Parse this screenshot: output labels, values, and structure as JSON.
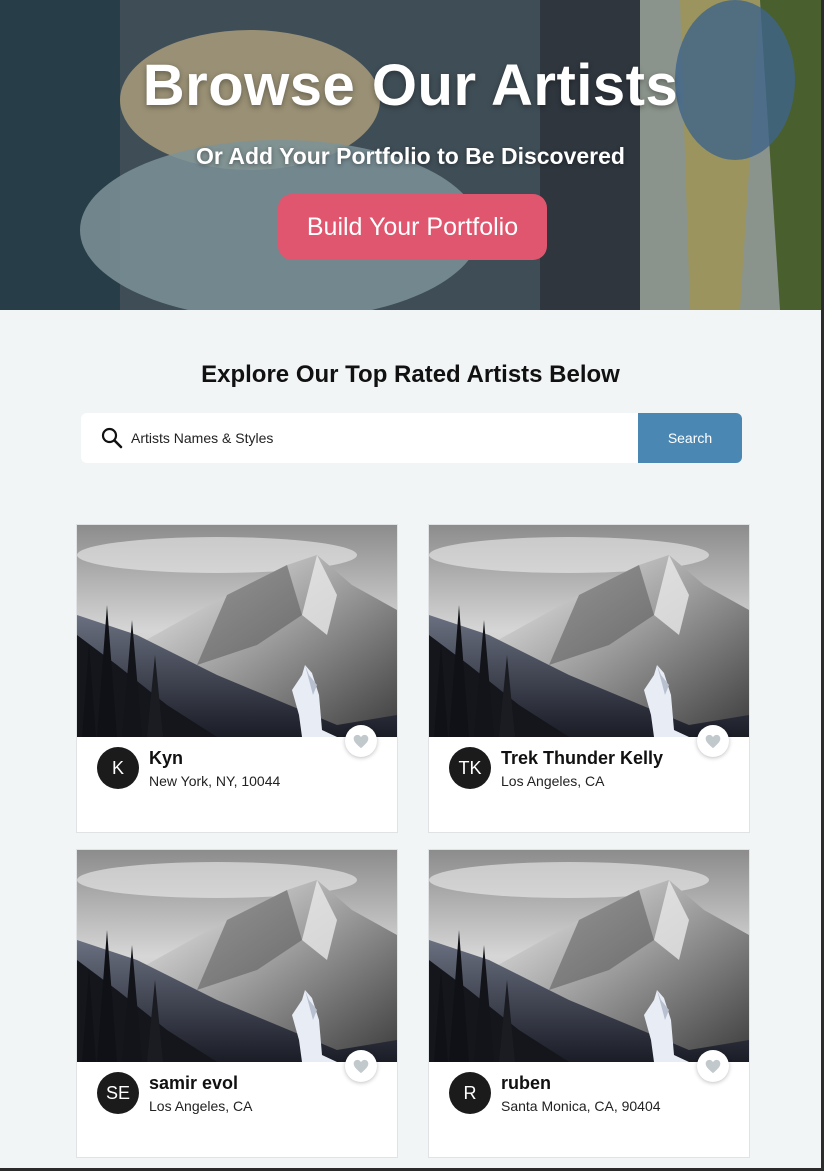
{
  "hero": {
    "title": "Browse Our Artists",
    "subtitle": "Or Add Your Portfolio to Be Discovered",
    "cta_label": "Build Your Portfolio",
    "cta_color": "#e0566e"
  },
  "explore": {
    "title": "Explore Our Top Rated Artists Below",
    "search": {
      "placeholder": "Artists Names & Styles",
      "icon": "search-icon",
      "button_label": "Search",
      "button_color": "#4a88b3"
    }
  },
  "artists": [
    {
      "initials": "K",
      "name": "Kyn",
      "location": "New York, NY, 10044",
      "favorite_icon": "heart-icon"
    },
    {
      "initials": "TK",
      "name": "Trek Thunder Kelly",
      "location": "Los Angeles, CA",
      "favorite_icon": "heart-icon"
    },
    {
      "initials": "SE",
      "name": "samir evol",
      "location": "Los Angeles, CA",
      "favorite_icon": "heart-icon"
    },
    {
      "initials": "R",
      "name": "ruben",
      "location": "Santa Monica, CA, 90404",
      "favorite_icon": "heart-icon"
    }
  ]
}
